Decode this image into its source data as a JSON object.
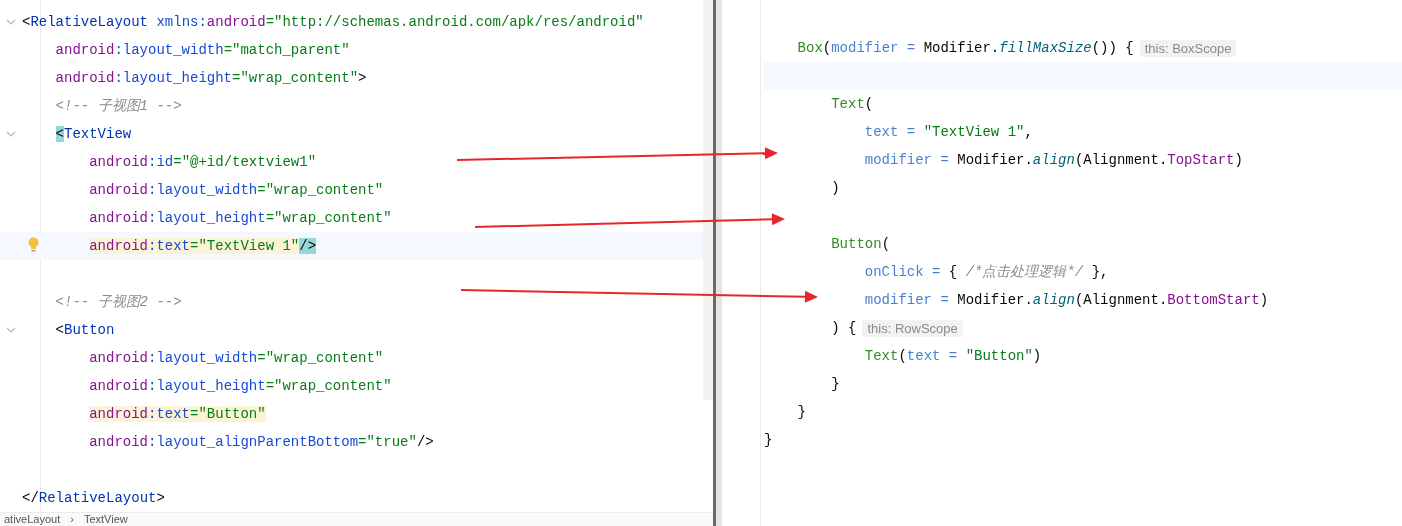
{
  "xml_editor": {
    "lines": [
      {
        "kind": "code",
        "fold": true,
        "tokens": [
          {
            "kind": "punct",
            "text": "<"
          },
          {
            "kind": "tag",
            "text": "RelativeLayout"
          },
          {
            "kind": "attr",
            "text": " xmlns:"
          },
          {
            "kind": "ns",
            "text": "android"
          },
          {
            "kind": "str",
            "text": "=\"http://schemas.android.com/apk/res/android\""
          }
        ],
        "children": [
          {
            "kind": "code",
            "tokens": [
              {
                "kind": "ns",
                "text": "android"
              },
              {
                "kind": "attr",
                "text": ":layout_width"
              },
              {
                "kind": "str",
                "text": "=\"match_parent\""
              }
            ]
          },
          {
            "kind": "code",
            "tokens": [
              {
                "kind": "ns",
                "text": "android"
              },
              {
                "kind": "attr",
                "text": ":layout_height"
              },
              {
                "kind": "str",
                "text": "=\"wrap_content\""
              },
              {
                "kind": "punct",
                "text": ">"
              }
            ]
          },
          {
            "kind": "code",
            "tokens": [
              {
                "kind": "comment",
                "text": "<!-- 子视图1 -->"
              }
            ]
          },
          {
            "kind": "code",
            "fold": true,
            "tokens": [
              {
                "kind": "punct",
                "text": "<",
                "brace_match": true
              },
              {
                "kind": "tag",
                "text": "TextView"
              }
            ],
            "children": [
              {
                "kind": "code",
                "tokens": [
                  {
                    "kind": "ns",
                    "text": "android"
                  },
                  {
                    "kind": "attr",
                    "text": ":id"
                  },
                  {
                    "kind": "str",
                    "text": "=\"@+id/textview1\""
                  }
                ]
              },
              {
                "kind": "code",
                "tokens": [
                  {
                    "kind": "ns",
                    "text": "android"
                  },
                  {
                    "kind": "attr",
                    "text": ":layout_width"
                  },
                  {
                    "kind": "str",
                    "text": "=\"wrap_content\""
                  }
                ]
              },
              {
                "kind": "code",
                "tokens": [
                  {
                    "kind": "ns",
                    "text": "android"
                  },
                  {
                    "kind": "attr",
                    "text": ":layout_height"
                  },
                  {
                    "kind": "str",
                    "text": "=\"wrap_content\""
                  }
                ]
              },
              {
                "kind": "code",
                "current": true,
                "bulb": true,
                "tokens": [
                  {
                    "kind": "ns",
                    "text": "android",
                    "warning": true
                  },
                  {
                    "kind": "attr",
                    "text": ":text",
                    "warning": true
                  },
                  {
                    "kind": "str",
                    "text": "=\"TextView 1\"",
                    "warning": true
                  },
                  {
                    "kind": "punct",
                    "text": "/>",
                    "brace_match": true
                  }
                ]
              }
            ]
          },
          {
            "kind": "blank"
          },
          {
            "kind": "code",
            "tokens": [
              {
                "kind": "comment",
                "text": "<!-- 子视图2 -->"
              }
            ]
          },
          {
            "kind": "code",
            "fold": true,
            "tokens": [
              {
                "kind": "punct",
                "text": "<"
              },
              {
                "kind": "tag",
                "text": "Button"
              }
            ],
            "children": [
              {
                "kind": "code",
                "tokens": [
                  {
                    "kind": "ns",
                    "text": "android"
                  },
                  {
                    "kind": "attr",
                    "text": ":layout_width"
                  },
                  {
                    "kind": "str",
                    "text": "=\"wrap_content\""
                  }
                ]
              },
              {
                "kind": "code",
                "tokens": [
                  {
                    "kind": "ns",
                    "text": "android"
                  },
                  {
                    "kind": "attr",
                    "text": ":layout_height"
                  },
                  {
                    "kind": "str",
                    "text": "=\"wrap_content\""
                  }
                ]
              },
              {
                "kind": "code",
                "tokens": [
                  {
                    "kind": "ns",
                    "text": "android",
                    "warning": true
                  },
                  {
                    "kind": "attr",
                    "text": ":text",
                    "warning": true
                  },
                  {
                    "kind": "str",
                    "text": "=\"Button\"",
                    "warning": true
                  }
                ]
              },
              {
                "kind": "code",
                "tokens": [
                  {
                    "kind": "ns",
                    "text": "android"
                  },
                  {
                    "kind": "attr",
                    "text": ":layout_alignParentBottom"
                  },
                  {
                    "kind": "str",
                    "text": "=\"true\""
                  },
                  {
                    "kind": "punct",
                    "text": "/>"
                  }
                ]
              }
            ]
          },
          {
            "kind": "blank"
          }
        ]
      },
      {
        "kind": "code",
        "tokens": [
          {
            "kind": "punct",
            "text": "</"
          },
          {
            "kind": "tag",
            "text": "RelativeLayout"
          },
          {
            "kind": "punct",
            "text": ">"
          }
        ]
      }
    ],
    "breadcrumb": [
      "ativeLayout",
      "›",
      "TextView"
    ]
  },
  "compose_editor": {
    "lines": [
      {
        "kind": "blank"
      },
      {
        "kind": "group",
        "children": [
          {
            "kind": "code",
            "tokens": [
              {
                "kind": "call",
                "text": "Box"
              },
              {
                "kind": "plain",
                "text": "("
              },
              {
                "kind": "param",
                "text": "modifier = "
              },
              {
                "kind": "plain",
                "text": "Modifier."
              },
              {
                "kind": "italic",
                "text": "fillMaxSize"
              },
              {
                "kind": "plain",
                "text": "()) {"
              }
            ],
            "hint": "this: BoxScope",
            "children": [
              {
                "kind": "blank",
                "current": true
              },
              {
                "kind": "code",
                "tokens": [
                  {
                    "kind": "call",
                    "text": "Text"
                  },
                  {
                    "kind": "plain",
                    "text": "("
                  }
                ],
                "children": [
                  {
                    "kind": "code",
                    "tokens": [
                      {
                        "kind": "param",
                        "text": "text = "
                      },
                      {
                        "kind": "str",
                        "text": "\"TextView 1\""
                      },
                      {
                        "kind": "plain",
                        "text": ","
                      }
                    ]
                  },
                  {
                    "kind": "code",
                    "tokens": [
                      {
                        "kind": "param",
                        "text": "modifier = "
                      },
                      {
                        "kind": "plain",
                        "text": "Modifier."
                      },
                      {
                        "kind": "italic",
                        "text": "align"
                      },
                      {
                        "kind": "plain",
                        "text": "(Alignment."
                      },
                      {
                        "kind": "const",
                        "text": "TopStart"
                      },
                      {
                        "kind": "plain",
                        "text": ")"
                      }
                    ]
                  }
                ]
              },
              {
                "kind": "code",
                "tokens": [
                  {
                    "kind": "plain",
                    "text": ")"
                  }
                ]
              },
              {
                "kind": "blank"
              },
              {
                "kind": "code",
                "tokens": [
                  {
                    "kind": "call",
                    "text": "Button"
                  },
                  {
                    "kind": "plain",
                    "text": "("
                  }
                ],
                "children": [
                  {
                    "kind": "code",
                    "tokens": [
                      {
                        "kind": "param",
                        "text": "onClick = "
                      },
                      {
                        "kind": "plain",
                        "text": "{ "
                      },
                      {
                        "kind": "comment",
                        "text": "/*点击处理逻辑*/"
                      },
                      {
                        "kind": "plain",
                        "text": " },"
                      }
                    ]
                  },
                  {
                    "kind": "code",
                    "tokens": [
                      {
                        "kind": "param",
                        "text": "modifier = "
                      },
                      {
                        "kind": "plain",
                        "text": "Modifier."
                      },
                      {
                        "kind": "italic",
                        "text": "align"
                      },
                      {
                        "kind": "plain",
                        "text": "(Alignment."
                      },
                      {
                        "kind": "const",
                        "text": "BottomStart"
                      },
                      {
                        "kind": "plain",
                        "text": ")"
                      }
                    ]
                  }
                ]
              },
              {
                "kind": "code",
                "tokens": [
                  {
                    "kind": "plain",
                    "text": ") {"
                  }
                ],
                "hint": "this: RowScope",
                "children": [
                  {
                    "kind": "code",
                    "tokens": [
                      {
                        "kind": "call",
                        "text": "Text"
                      },
                      {
                        "kind": "plain",
                        "text": "("
                      },
                      {
                        "kind": "param",
                        "text": "text = "
                      },
                      {
                        "kind": "str",
                        "text": "\"Button\""
                      },
                      {
                        "kind": "plain",
                        "text": ")"
                      }
                    ]
                  }
                ]
              },
              {
                "kind": "code",
                "tokens": [
                  {
                    "kind": "plain",
                    "text": "}"
                  }
                ]
              }
            ]
          },
          {
            "kind": "code",
            "tokens": [
              {
                "kind": "plain",
                "text": "}"
              }
            ]
          }
        ]
      },
      {
        "kind": "code",
        "tokens": [
          {
            "kind": "plain",
            "text": "}"
          }
        ]
      }
    ]
  }
}
